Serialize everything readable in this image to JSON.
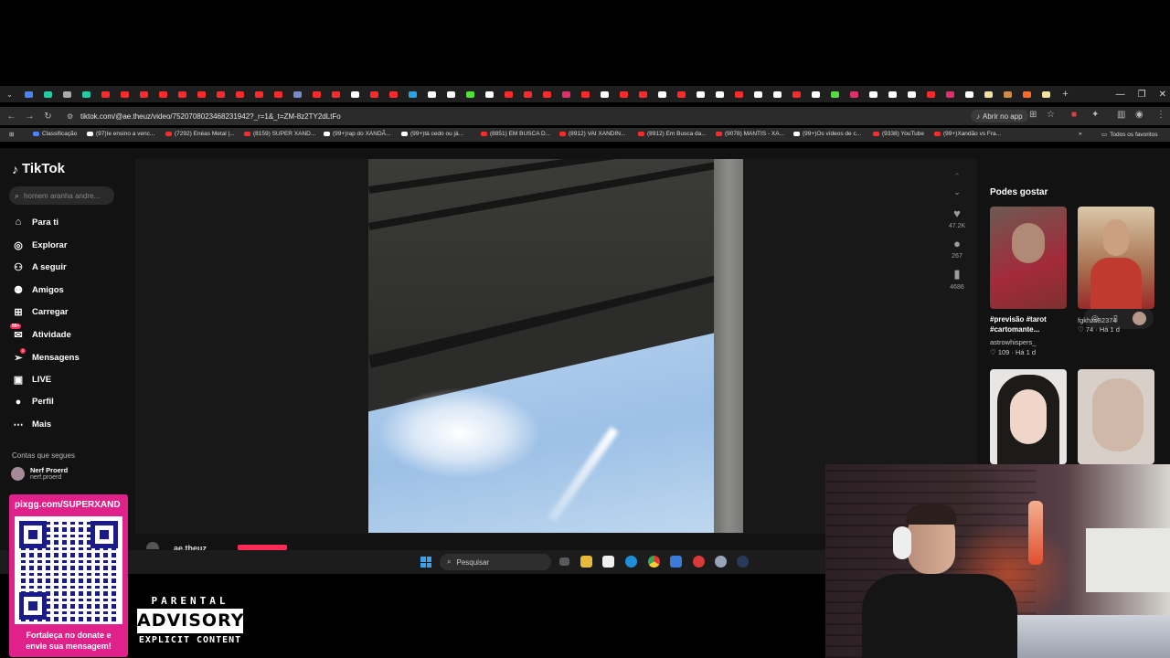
{
  "browser": {
    "url": "tiktok.com/@ae.theuz/video/7520708023468231942?_r=1&_t=ZM-8z2TY2dLtFo",
    "open_app_label": "Abrir no app",
    "tab_favicon_colors": [
      "#4b83ff",
      "#25c9a4",
      "#aaaaaa",
      "#25c9a4",
      "#ff2a2a",
      "#ff2a2a",
      "#ff2a2a",
      "#ff2a2a",
      "#ff2a2a",
      "#ff2a2a",
      "#ff2a2a",
      "#ff2a2a",
      "#ff2a2a",
      "#ff2a2a",
      "#7a8ac8",
      "#ff2a2a",
      "#ff2a2a",
      "#ffffff",
      "#ff2a2a",
      "#ff2a2a",
      "#2aa3e0",
      "#ffffff",
      "#ffffff",
      "#52e03b",
      "#ffffff",
      "#ff2a2a",
      "#ff2a2a",
      "#ff2a2a",
      "#e0306a",
      "#ff2a2a",
      "#ffffff",
      "#ff2a2a",
      "#ff2a2a",
      "#ffffff",
      "#ff2a2a",
      "#ffffff",
      "#ffffff",
      "#ff2a2a",
      "#ffffff",
      "#ffffff",
      "#ff2a2a",
      "#ffffff",
      "#52e03b",
      "#e0306a",
      "#ffffff",
      "#ffffff",
      "#ffffff",
      "#ff2a2a",
      "#e0306a",
      "#ffffff",
      "#f0e2a0",
      "#d08a4a",
      "#ff6a2a",
      "#f0e2a0"
    ],
    "bookmarks": [
      {
        "label": "Classificação",
        "color": "#4b83ff"
      },
      {
        "label": "(97)Ie ensino a venc...",
        "color": "#ffffff"
      },
      {
        "label": "(7292) Enéas Metal |...",
        "color": "#ff2a2a"
      },
      {
        "label": "(8159) SUPER XAND...",
        "color": "#ff2a2a"
      },
      {
        "label": "(99+)rap do XANDÃ...",
        "color": "#ffffff"
      },
      {
        "label": "(99+)tá cedo ou já...",
        "color": "#ffffff"
      },
      {
        "label": "(8851) EM BUSCA D...",
        "color": "#ff2a2a"
      },
      {
        "label": "(8912) VAI XANDIN...",
        "color": "#ff2a2a"
      },
      {
        "label": "(8912) Em Busca da...",
        "color": "#ff2a2a"
      },
      {
        "label": "(9078) MANTIS - XA...",
        "color": "#ff2a2a"
      },
      {
        "label": "(99+)Os vídeos de c...",
        "color": "#ffffff"
      },
      {
        "label": "(9338) YouTube",
        "color": "#ff2a2a"
      },
      {
        "label": "(99+)Xandão vs Fra...",
        "color": "#ff2a2a"
      }
    ],
    "all_favorites_label": "Todos os favoritos"
  },
  "tiktok": {
    "brand": "TikTok",
    "search_placeholder": "homem aranha andre...",
    "nav": [
      {
        "label": "Para ti",
        "icon": "home-icon"
      },
      {
        "label": "Explorar",
        "icon": "compass-icon"
      },
      {
        "label": "A seguir",
        "icon": "following-icon"
      },
      {
        "label": "Amigos",
        "icon": "friends-icon"
      },
      {
        "label": "Carregar",
        "icon": "upload-icon"
      },
      {
        "label": "Atividade",
        "icon": "activity-icon",
        "badge": "99+"
      },
      {
        "label": "Mensagens",
        "icon": "messages-icon",
        "badge": "1"
      },
      {
        "label": "LIVE",
        "icon": "live-icon"
      },
      {
        "label": "Perfil",
        "icon": "profile-icon"
      },
      {
        "label": "Mais",
        "icon": "more-icon"
      }
    ],
    "following_title": "Contas que segues",
    "following": [
      {
        "name": "Nerf Proerd",
        "handle": "nerf.proerd"
      }
    ],
    "video": {
      "author": "ae.theuz",
      "likes": "47.2K",
      "comments": "267",
      "saves": "4686"
    },
    "recommend_title": "Podes gostar",
    "recommendations": [
      {
        "caption": "#previsão #tarot #cartomante...",
        "user": "astrowhispers_",
        "likes": "109",
        "age": "Há 1 d"
      },
      {
        "caption": "",
        "user": "fgkhzs82374",
        "likes": "74",
        "age": "Há 1 d"
      }
    ]
  },
  "taskbar": {
    "search_placeholder": "Pesquisar"
  },
  "overlay": {
    "stream_url": "pixgg.com/SUPERXAND",
    "stream_message_line1": "Fortaleça no donate e",
    "stream_message_line2": "envie sua mensagem!",
    "parental_top": "PARENTAL",
    "parental_mid": "ADVISORY",
    "parental_bot": "EXPLICIT CONTENT"
  },
  "colors": {
    "accent": "#fe2c55",
    "panel_pink": "#e0218a"
  }
}
